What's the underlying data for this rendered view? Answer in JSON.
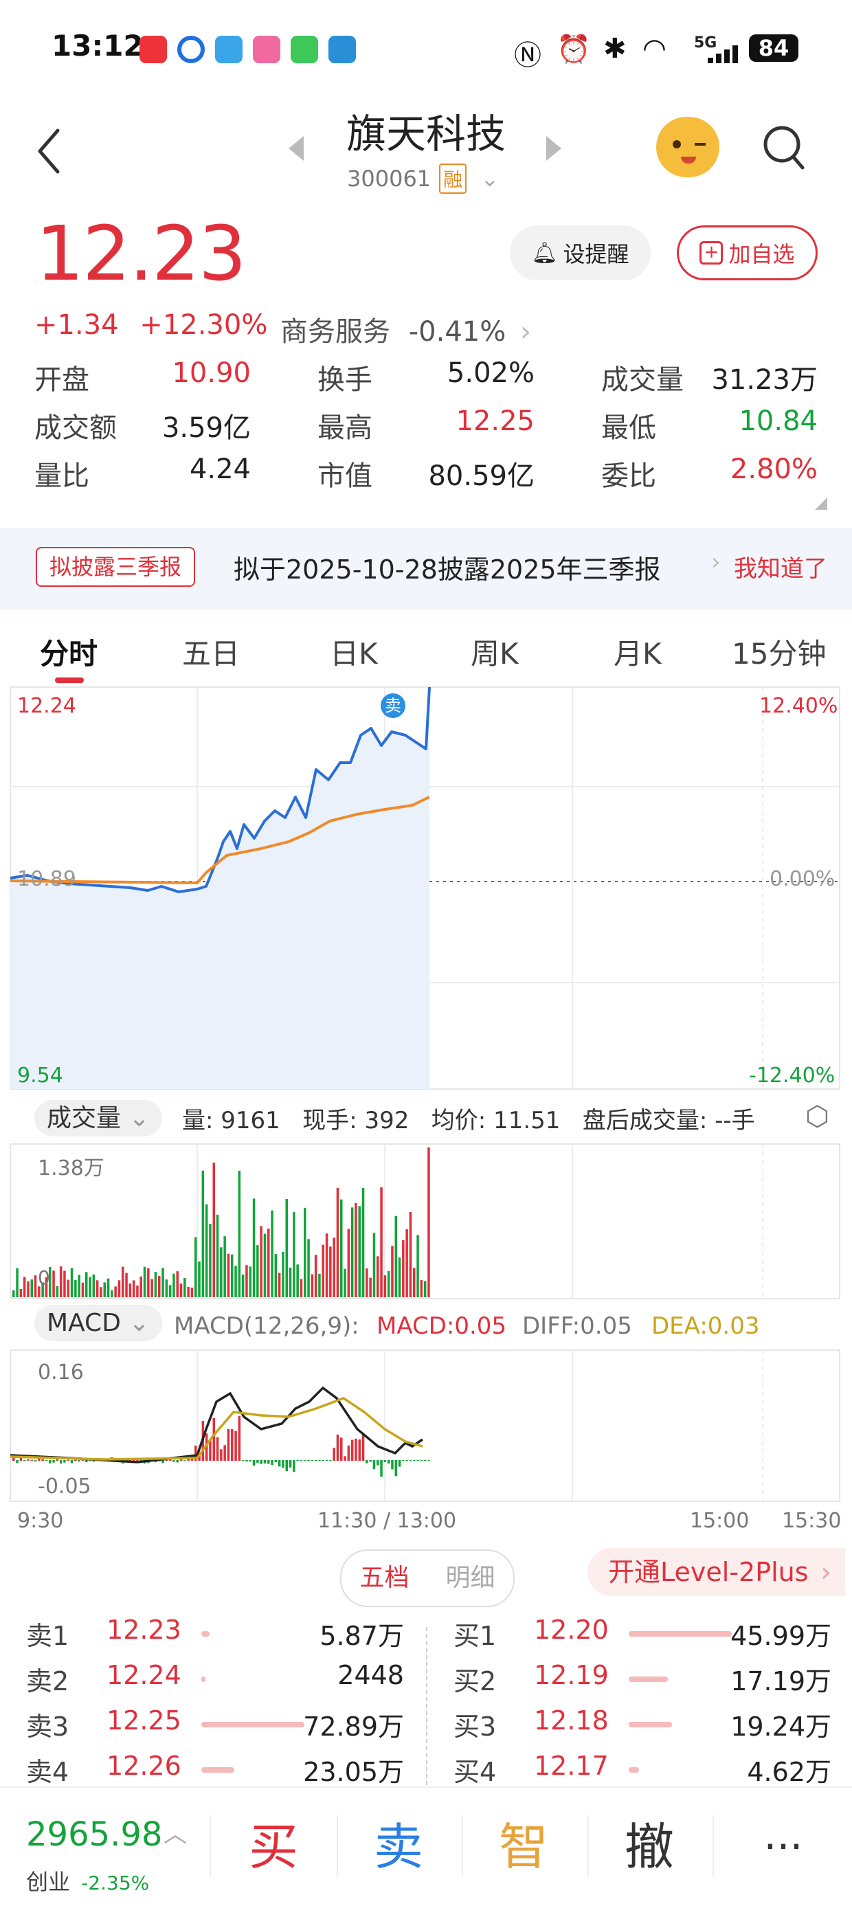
{
  "status": {
    "time": "13:12",
    "battery": "84",
    "network": "5G"
  },
  "header": {
    "name": "旗天科技",
    "code": "300061",
    "margin_tag": "融"
  },
  "quote": {
    "price": "12.23",
    "change": "+1.34",
    "change_pct": "+12.30%",
    "sector": "商务服务",
    "sector_change": "-0.41%",
    "remind_label": "设提醒",
    "add_label": "加自选",
    "stats": [
      {
        "k": "开盘",
        "v": "10.90",
        "c": "red"
      },
      {
        "k": "换手",
        "v": "5.02%",
        "c": ""
      },
      {
        "k": "成交量",
        "v": "31.23万",
        "c": ""
      },
      {
        "k": "成交额",
        "v": "3.59亿",
        "c": ""
      },
      {
        "k": "最高",
        "v": "12.25",
        "c": "red"
      },
      {
        "k": "最低",
        "v": "10.84",
        "c": "green"
      },
      {
        "k": "量比",
        "v": "4.24",
        "c": ""
      },
      {
        "k": "市值",
        "v": "80.59亿",
        "c": ""
      },
      {
        "k": "委比",
        "v": "2.80%",
        "c": "red"
      }
    ]
  },
  "banner": {
    "tag": "拟披露三季报",
    "text": "拟于2025-10-28披露2025年三季报",
    "ok": "我知道了"
  },
  "tabs": [
    "分时",
    "五日",
    "日K",
    "周K",
    "月K",
    "15分钟"
  ],
  "intraday": {
    "price_high": "12.24",
    "price_mid": "10.89",
    "price_low": "9.54",
    "pct_high": "12.40%",
    "pct_mid": "0.00%",
    "pct_low": "-12.40%",
    "sell_marker": "卖",
    "time_labels": [
      "9:30",
      "11:30 / 13:00",
      "15:00",
      "15:30"
    ]
  },
  "volume": {
    "dropdown": "成交量",
    "text": "量: 9161   现手: 392   均价: 11.51   盘后成交量: --手",
    "max": "1.38万",
    "zero": "0"
  },
  "macd": {
    "dropdown": "MACD",
    "params": "MACD(12,26,9):",
    "macd": "MACD:0.05",
    "diff": "DIFF:0.05",
    "dea": "DEA:0.03",
    "max": "0.16",
    "min": "-0.05"
  },
  "orderbook": {
    "tab_active": "五档",
    "tab_other": "明细",
    "level2": "开通Level-2Plus",
    "sell": [
      {
        "label": "卖1",
        "price": "12.23",
        "vol": "5.87万",
        "fill": 0.08
      },
      {
        "label": "卖2",
        "price": "12.24",
        "vol": "2448",
        "fill": 0.0
      },
      {
        "label": "卖3",
        "price": "12.25",
        "vol": "72.89万",
        "fill": 1.0
      },
      {
        "label": "卖4",
        "price": "12.26",
        "vol": "23.05万",
        "fill": 0.32
      }
    ],
    "buy": [
      {
        "label": "买1",
        "price": "12.20",
        "vol": "45.99万",
        "fill": 1.0
      },
      {
        "label": "买2",
        "price": "12.19",
        "vol": "17.19万",
        "fill": 0.38
      },
      {
        "label": "买3",
        "price": "12.18",
        "vol": "19.24万",
        "fill": 0.42
      },
      {
        "label": "买4",
        "price": "12.17",
        "vol": "4.62万",
        "fill": 0.1
      }
    ]
  },
  "bottom": {
    "index_value": "2965.98",
    "index_name": "创业",
    "index_change": "-2.35%",
    "buy": "买",
    "sell": "卖",
    "smart": "智",
    "cancel": "撤",
    "more": "···"
  },
  "colors": {
    "up": "#e0303b",
    "down": "#12a43a",
    "line": "#2b6fd6",
    "avg": "#f08a2a",
    "dea": "#c8a51a"
  }
}
